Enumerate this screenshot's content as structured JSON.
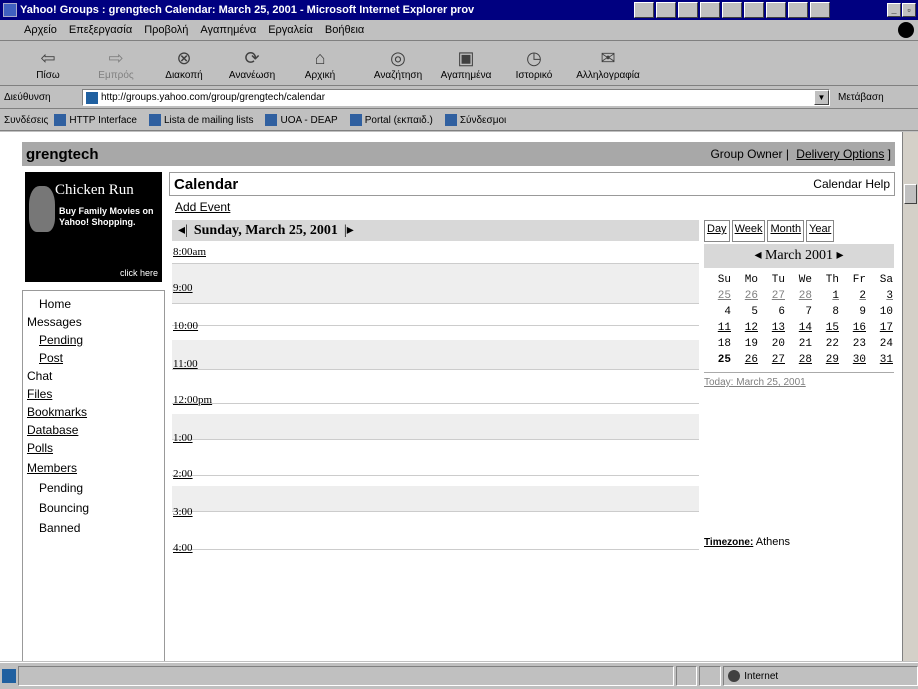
{
  "window": {
    "title": "Yahoo! Groups : grengtech Calendar: March 25, 2001 - Microsoft Internet Explorer prov"
  },
  "menu": [
    "Αρχείο",
    "Επεξεργασία",
    "Προβολή",
    "Αγαπημένα",
    "Εργαλεία",
    "Βοήθεια"
  ],
  "toolbar": [
    {
      "icon": "back-icon",
      "label": "Πίσω",
      "enabled": true
    },
    {
      "icon": "forward-icon",
      "label": "Εμπρός",
      "enabled": false
    },
    {
      "icon": "stop-icon",
      "label": "Διακοπή",
      "enabled": true
    },
    {
      "icon": "refresh-icon",
      "label": "Ανανέωση",
      "enabled": true
    },
    {
      "icon": "home-icon",
      "label": "Αρχική",
      "enabled": true
    },
    {
      "icon": "search-icon",
      "label": "Αναζήτηση",
      "enabled": true
    },
    {
      "icon": "favorites-icon",
      "label": "Αγαπημένα",
      "enabled": true
    },
    {
      "icon": "history-icon",
      "label": "Ιστορικό",
      "enabled": true
    },
    {
      "icon": "mail-icon",
      "label": "Αλληλογραφία",
      "enabled": true
    }
  ],
  "address": {
    "label": "Διεύθυνση",
    "url": "http://groups.yahoo.com/group/grengtech/calendar",
    "go": "Μετάβαση"
  },
  "links": {
    "label": "Συνδέσεις",
    "items": [
      "HTTP Interface",
      "Lista de mailing lists",
      "UOA - DEAP",
      "Portal (εκπαιδ.)",
      "Σύνδεσμοι"
    ]
  },
  "page": {
    "group_name": "grengtech",
    "group_owner": "Group Owner",
    "delivery_options": "Delivery Options",
    "ad": {
      "title": "Chicken Run",
      "body": "Buy Family Movies on Yahoo! Shopping.",
      "click": "click here"
    },
    "sidebar": [
      "Home",
      "Messages",
      "Pending",
      "Post",
      "Chat",
      "Files",
      "Bookmarks",
      "Database",
      "Polls",
      "Members",
      "Pending",
      "Bouncing",
      "Banned"
    ],
    "calendar_title": "Calendar",
    "calendar_help": "Calendar Help",
    "add_event": "Add Event",
    "day_title": "Sunday, March 25, 2001",
    "time_slots": [
      "8:00am",
      "9:00",
      "10:00",
      "11:00",
      "12:00pm",
      "1:00",
      "2:00",
      "3:00",
      "4:00"
    ],
    "view_tabs": [
      "Day",
      "Week",
      "Month",
      "Year"
    ],
    "mini_month": "March 2001",
    "weekdays": [
      "Su",
      "Mo",
      "Tu",
      "We",
      "Th",
      "Fr",
      "Sa"
    ],
    "weeks": [
      [
        "25",
        "26",
        "27",
        "28",
        "1",
        "2",
        "3"
      ],
      [
        "4",
        "5",
        "6",
        "7",
        "8",
        "9",
        "10"
      ],
      [
        "11",
        "12",
        "13",
        "14",
        "15",
        "16",
        "17"
      ],
      [
        "18",
        "19",
        "20",
        "21",
        "22",
        "23",
        "24"
      ],
      [
        "25",
        "26",
        "27",
        "28",
        "29",
        "30",
        "31"
      ]
    ],
    "today": "Today: March 25, 2001",
    "timezone_label": "Timezone:",
    "timezone_value": "Athens"
  },
  "status": {
    "zone": "Internet"
  }
}
